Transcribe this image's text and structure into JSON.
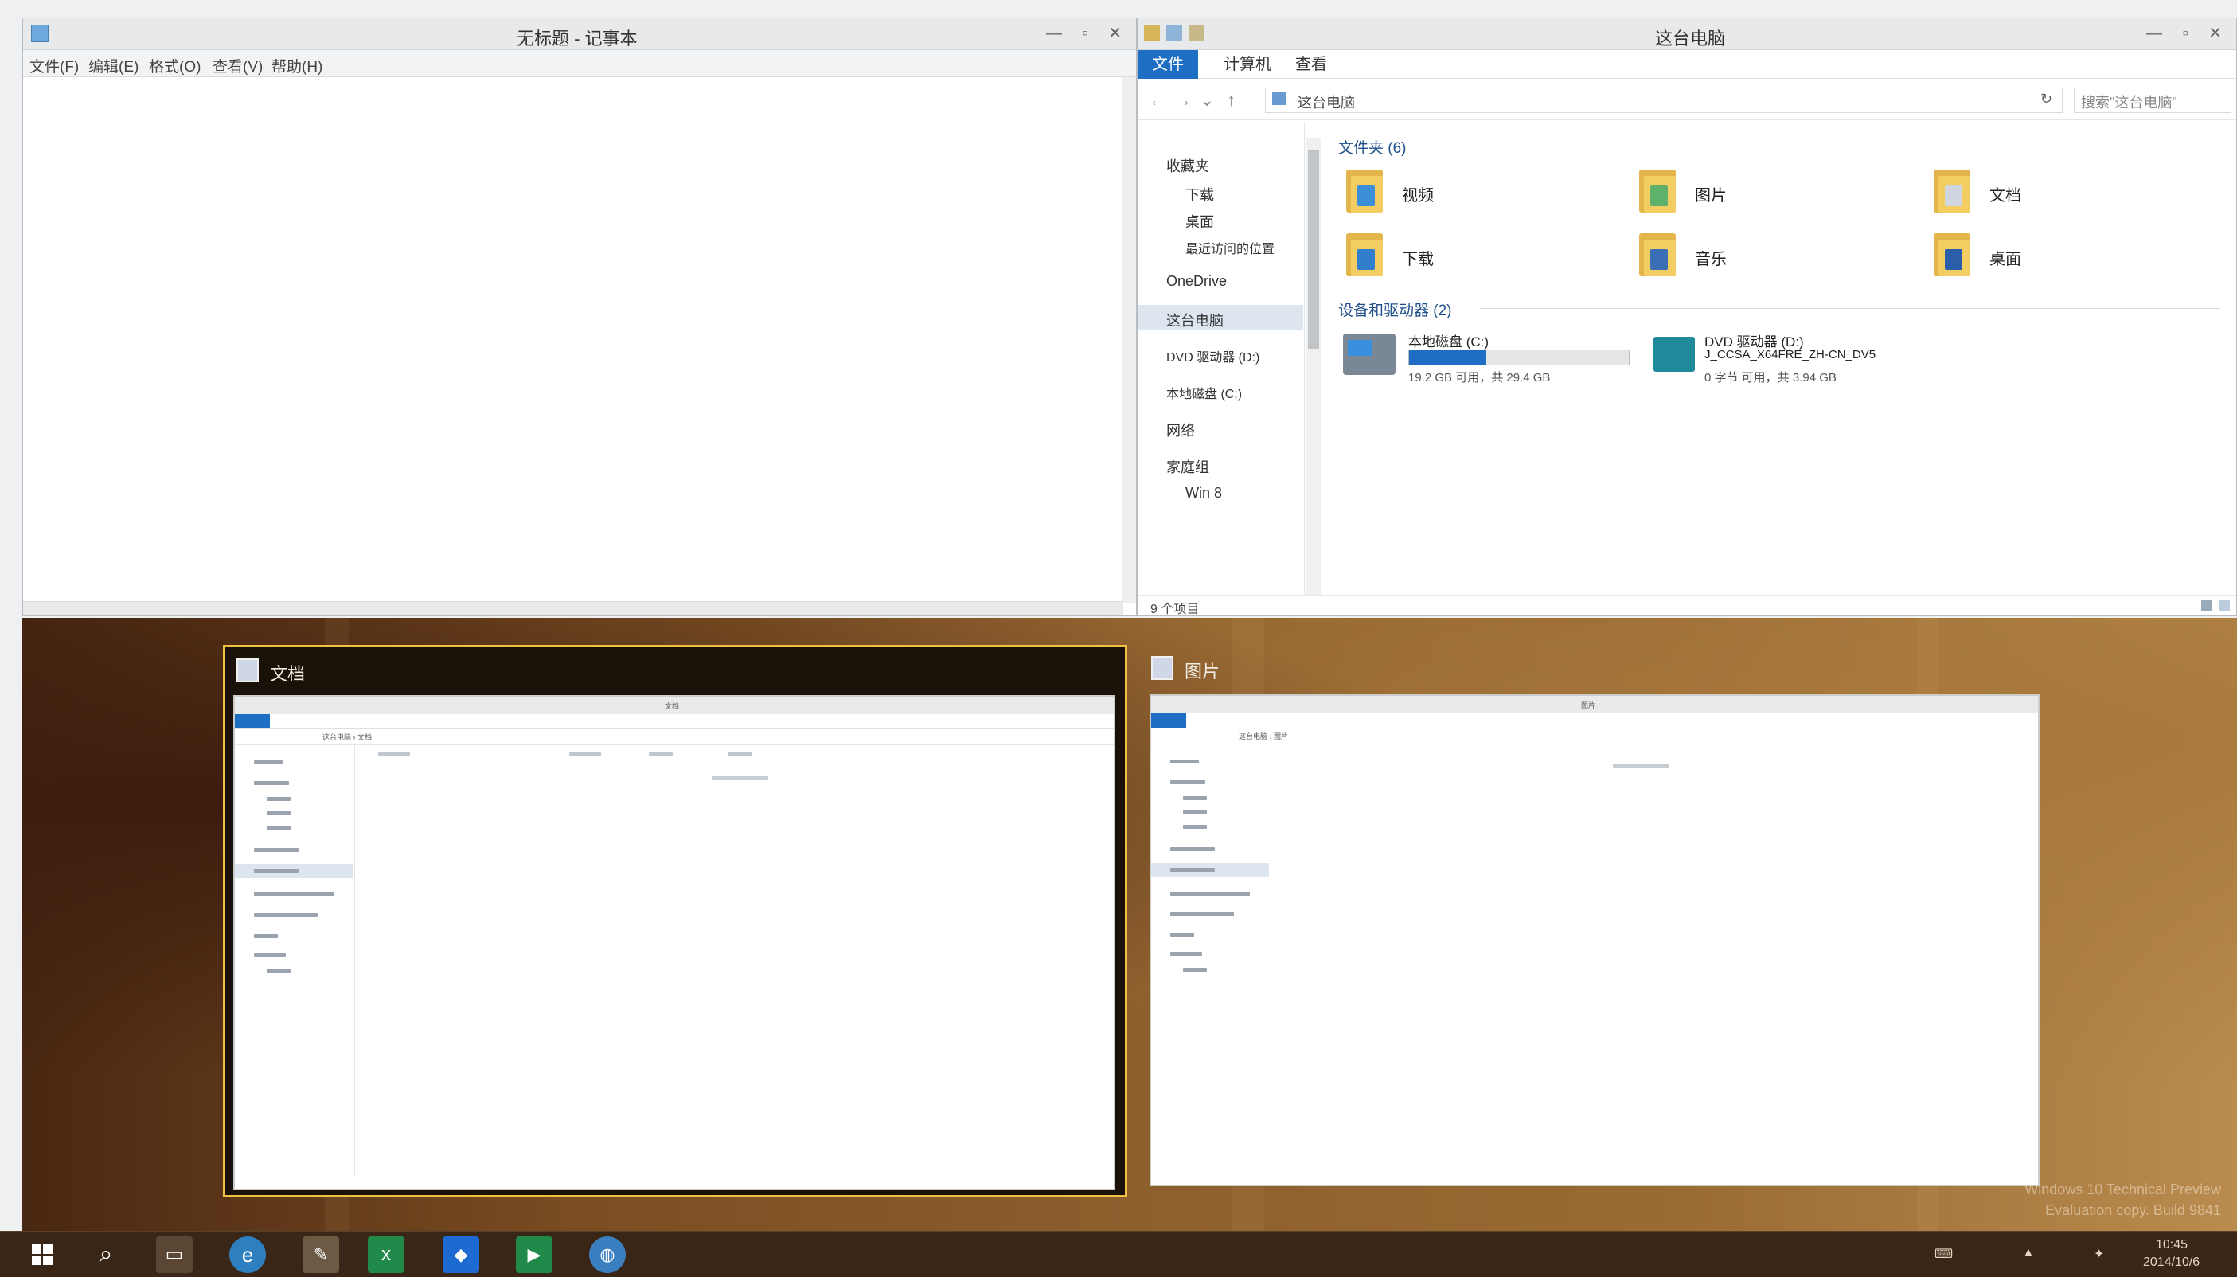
{
  "notepad": {
    "title": "无标题 - 记事本",
    "menu": [
      "文件(F)",
      "编辑(E)",
      "格式(O)",
      "查看(V)",
      "帮助(H)"
    ],
    "content": ""
  },
  "explorer": {
    "title": "这台电脑",
    "tabs": [
      "文件",
      "计算机",
      "查看"
    ],
    "address": "这台电脑",
    "search_placeholder": "搜索\"这台电脑\"",
    "nav": [
      "收藏夹",
      "下载",
      "桌面",
      "最近访问的位置",
      "OneDrive",
      "这台电脑",
      "DVD 驱动器 (D:)",
      "本地磁盘 (C:)",
      "网络",
      "家庭组",
      "Win 8"
    ],
    "folders_header": "文件夹 (6)",
    "folders": [
      "视频",
      "图片",
      "文档",
      "下载",
      "音乐",
      "桌面"
    ],
    "devices_header": "设备和驱动器 (2)",
    "drive_c": {
      "name": "本地磁盘 (C:)",
      "free": "19.2 GB 可用，共 29.4 GB",
      "used_fraction": 0.35
    },
    "drive_d": {
      "name": "DVD 驱动器 (D:)",
      "label": "J_CCSA_X64FRE_ZH-CN_DV5",
      "free": "0 字节 可用，共 3.94 GB"
    },
    "status": "9 个项目"
  },
  "thumbnails": [
    {
      "label": "文档",
      "path": "这台电脑 › 文档",
      "selected": true
    },
    {
      "label": "图片",
      "path": "这台电脑 › 图片",
      "selected": false
    }
  ],
  "taskbar": {
    "apps": [
      "start-icon",
      "search-icon",
      "file-explorer-icon",
      "internet-explorer-icon",
      "paint-icon",
      "excel-icon",
      "store-icon",
      "media-icon",
      "network-icon"
    ],
    "time": "10:45",
    "date": "2014/10/6"
  },
  "watermark": {
    "line1": "Windows 10 Technical Preview",
    "line2": "Evaluation copy. Build 9841"
  },
  "colors": {
    "accent": "#1e6fc4",
    "selection_border": "#f0c040",
    "desktop": "#7a4d22"
  }
}
